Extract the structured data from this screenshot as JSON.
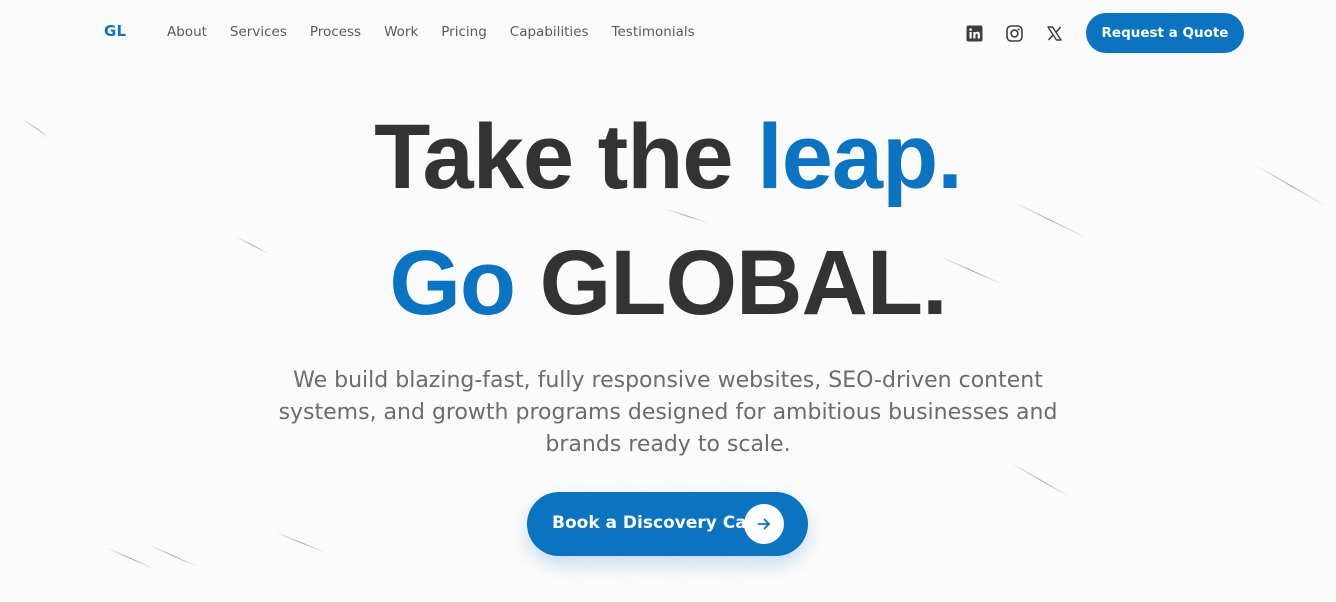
{
  "brand": {
    "logo_text": "GL",
    "accent_color": "#0a74c2"
  },
  "nav": {
    "items": [
      {
        "label": "About"
      },
      {
        "label": "Services"
      },
      {
        "label": "Process"
      },
      {
        "label": "Work"
      },
      {
        "label": "Pricing"
      },
      {
        "label": "Capabilities"
      },
      {
        "label": "Testimonials"
      }
    ]
  },
  "socials": {
    "items": [
      {
        "icon": "linkedin-icon"
      },
      {
        "icon": "instagram-icon"
      },
      {
        "icon": "x-icon"
      }
    ]
  },
  "header": {
    "quote_button_label": "Request a Quote"
  },
  "hero": {
    "line1_part1": "Take the ",
    "line1_accent": "leap.",
    "line2_accent": "Go",
    "line2_part2": " GLOBAL.",
    "subtitle": "We build blazing-fast, fully responsive websites, SEO-driven content systems, and growth programs designed for ambitious businesses and brands ready to scale.",
    "cta_label": "Book a Discovery Call",
    "cta_icon": "arrow-right-icon"
  }
}
